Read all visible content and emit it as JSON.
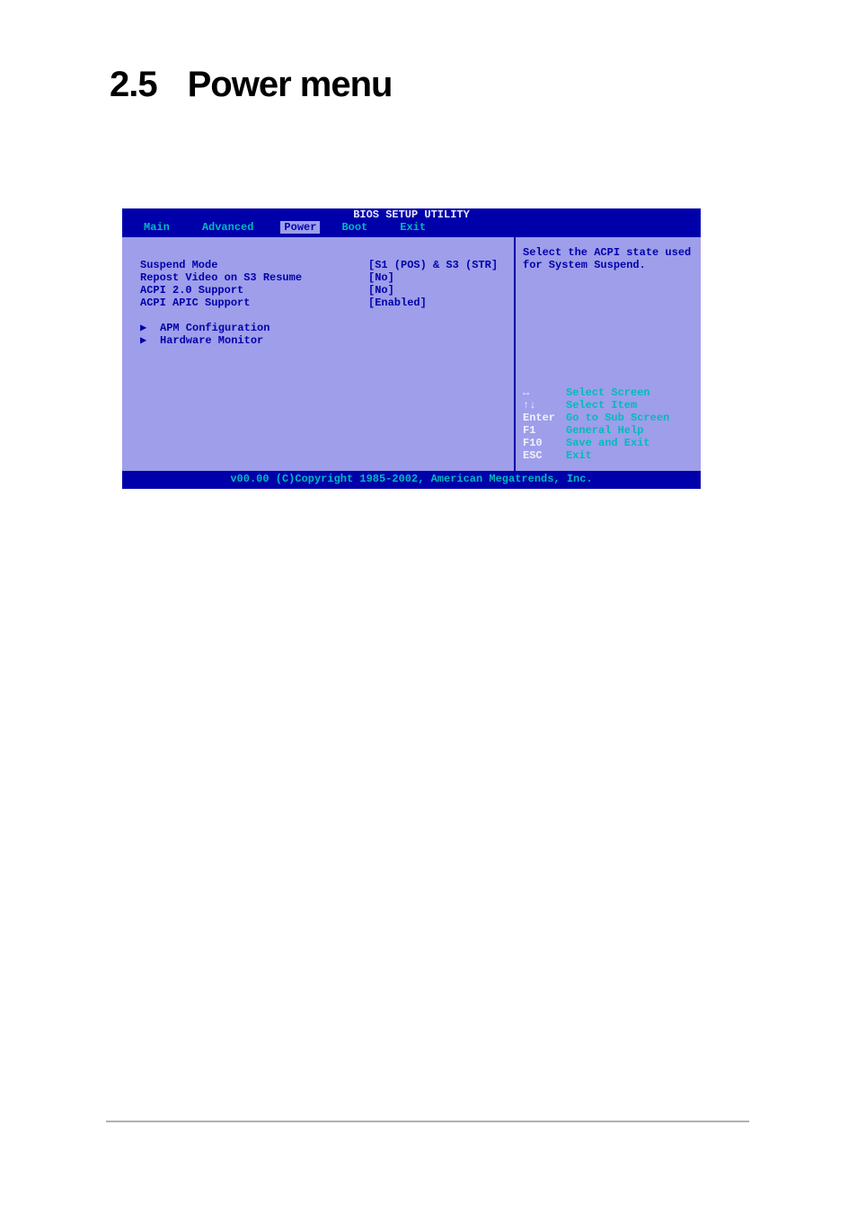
{
  "heading": {
    "number": "2.5",
    "text": "Power menu"
  },
  "bios": {
    "title": "BIOS SETUP UTILITY",
    "menus": {
      "main": "Main",
      "advanced": "Advanced",
      "power": "Power",
      "boot": "Boot",
      "exit": "Exit"
    },
    "settings": [
      {
        "label": "Suspend Mode",
        "value": "[S1 (POS) & S3 (STR]"
      },
      {
        "label": "Repost Video on S3 Resume",
        "value": "[No]"
      },
      {
        "label": "ACPI 2.0 Support",
        "value": "[No]"
      },
      {
        "label": "ACPI APIC Support",
        "value": "[Enabled]"
      }
    ],
    "submenus": [
      "APM Configuration",
      "Hardware Monitor"
    ],
    "help": "Select the ACPI state used for System Suspend.",
    "keys": [
      {
        "key": "↔",
        "desc": "Select Screen"
      },
      {
        "key": "↑↓",
        "desc": "Select Item"
      },
      {
        "key": "Enter",
        "desc": "Go to Sub Screen"
      },
      {
        "key": "F1",
        "desc": "General Help"
      },
      {
        "key": "F10",
        "desc": "Save and Exit"
      },
      {
        "key": "ESC",
        "desc": "Exit"
      }
    ],
    "footer": "v00.00 (C)Copyright 1985-2002, American Megatrends, Inc."
  }
}
